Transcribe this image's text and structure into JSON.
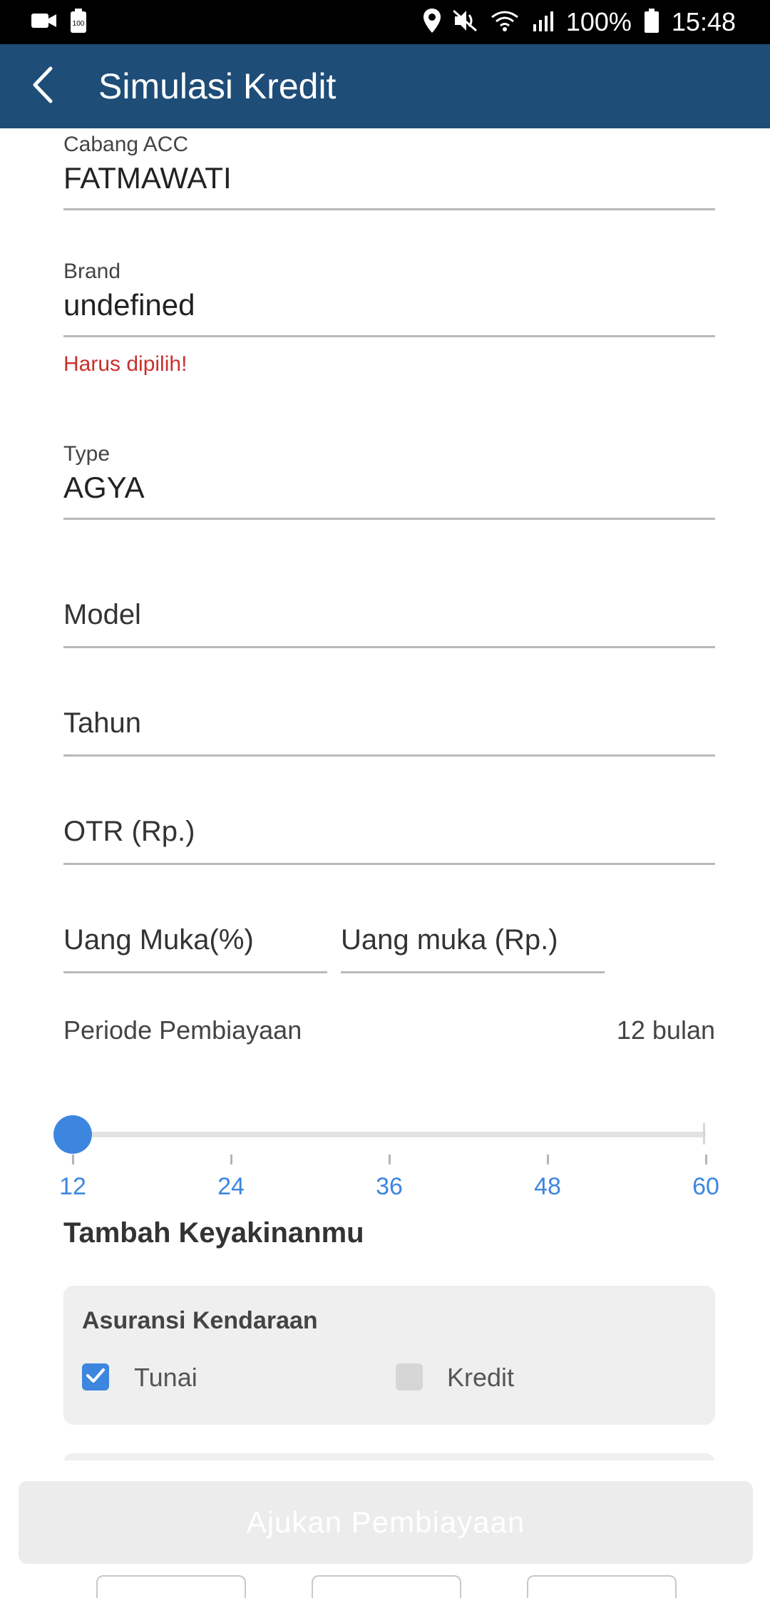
{
  "status_bar": {
    "battery_percent": "100%",
    "time": "15:48",
    "icons_left": [
      "video-camera-icon",
      "battery-saver-icon"
    ],
    "icons_right": [
      "location-icon",
      "mute-icon",
      "wifi-icon",
      "signal-icon",
      "battery-icon"
    ]
  },
  "app_bar": {
    "title": "Simulasi Kredit",
    "back_icon": "chevron-left-icon",
    "background": "#1e4d78"
  },
  "form": {
    "cabang": {
      "label": "Cabang ACC",
      "value": "FATMAWATI"
    },
    "brand": {
      "label": "Brand",
      "value": "undefined",
      "error": "Harus dipilih!"
    },
    "type": {
      "label": "Type",
      "value": "AGYA"
    },
    "model": {
      "placeholder": "Model"
    },
    "tahun": {
      "placeholder": "Tahun"
    },
    "otr": {
      "placeholder": "OTR (Rp.)"
    },
    "uang_muka_pct": {
      "placeholder": "Uang Muka(%)"
    },
    "uang_muka_rp": {
      "placeholder": "Uang muka (Rp.)"
    }
  },
  "periode": {
    "label": "Periode Pembiayaan",
    "value_text": "12 bulan",
    "slider": {
      "min": 12,
      "max": 60,
      "value": 12,
      "ticks": [
        "12",
        "24",
        "36",
        "48",
        "60"
      ],
      "accent_color": "#3d86df"
    }
  },
  "extras": {
    "title": "Tambah Keyakinanmu",
    "asuransi": {
      "title": "Asuransi Kendaraan",
      "options": [
        {
          "label": "Tunai",
          "checked": true
        },
        {
          "label": "Kredit",
          "checked": false
        }
      ]
    }
  },
  "submit": {
    "label": "Ajukan Pembiayaan",
    "enabled": false
  },
  "colors": {
    "error": "#c9302c",
    "accent": "#3d86df"
  }
}
